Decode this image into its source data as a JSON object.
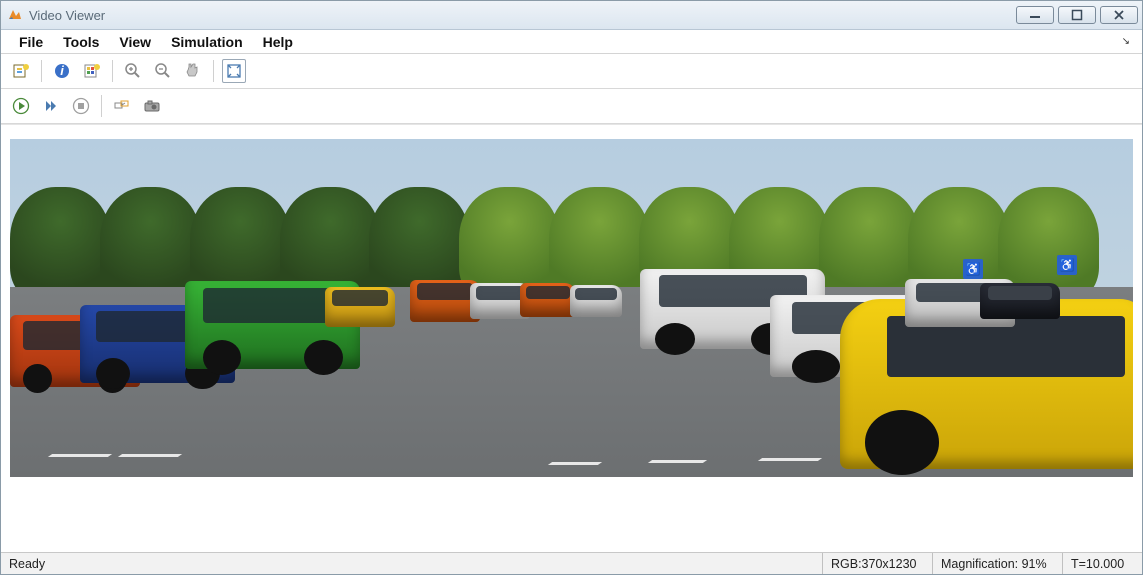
{
  "window": {
    "title": "Video Viewer"
  },
  "menu": {
    "file": "File",
    "tools": "Tools",
    "view": "View",
    "simulation": "Simulation",
    "help": "Help"
  },
  "icons": {
    "new": "new-video-icon",
    "info": "info-icon",
    "colormap": "colormap-icon",
    "zoom_in": "zoom-in-icon",
    "zoom_out": "zoom-out-icon",
    "pan": "pan-icon",
    "fit": "fit-to-window-icon",
    "play": "play-icon",
    "step": "step-forward-icon",
    "stop": "stop-icon",
    "highlight": "highlight-icon",
    "snapshot": "snapshot-icon"
  },
  "status": {
    "ready": "Ready",
    "rgb": "RGB:370x1230",
    "mag": "Magnification: 91%",
    "time": "T=10.000"
  }
}
